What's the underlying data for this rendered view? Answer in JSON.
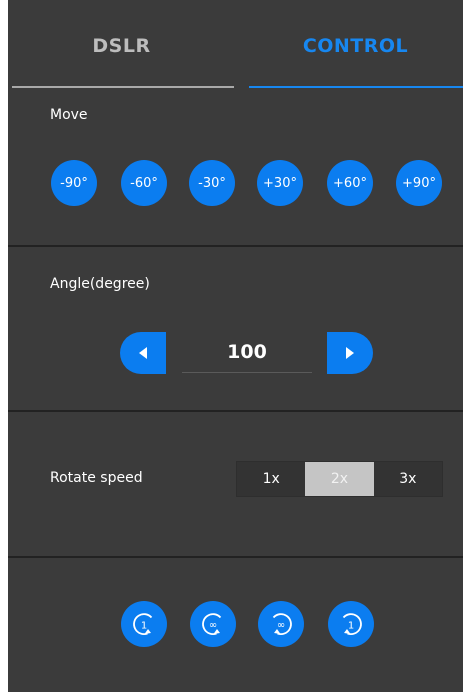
{
  "tabs": {
    "dslr": "DSLR",
    "control": "CONTROL",
    "active": "CONTROL"
  },
  "move": {
    "label": "Move",
    "buttons": [
      "-90°",
      "-60°",
      "-30°",
      "+30°",
      "+60°",
      "+90°"
    ]
  },
  "angle": {
    "label": "Angle(degree)",
    "value": "100",
    "decrease_icon": "triangle-left-icon",
    "increase_icon": "triangle-right-icon"
  },
  "speed": {
    "label": "Rotate speed",
    "options": [
      "1x",
      "2x",
      "3x"
    ],
    "selected": "2x"
  },
  "rotate": {
    "buttons": [
      {
        "icon": "rotate-ccw-once-icon",
        "text": "1"
      },
      {
        "icon": "rotate-ccw-infinite-icon",
        "text": "∞"
      },
      {
        "icon": "rotate-cw-infinite-icon",
        "text": "∞"
      },
      {
        "icon": "rotate-cw-once-icon",
        "text": "1"
      }
    ]
  },
  "colors": {
    "background": "#3b3b3b",
    "accent": "#0b7df0",
    "divider": "#222222",
    "selected_segment": "#c5c5c5"
  }
}
